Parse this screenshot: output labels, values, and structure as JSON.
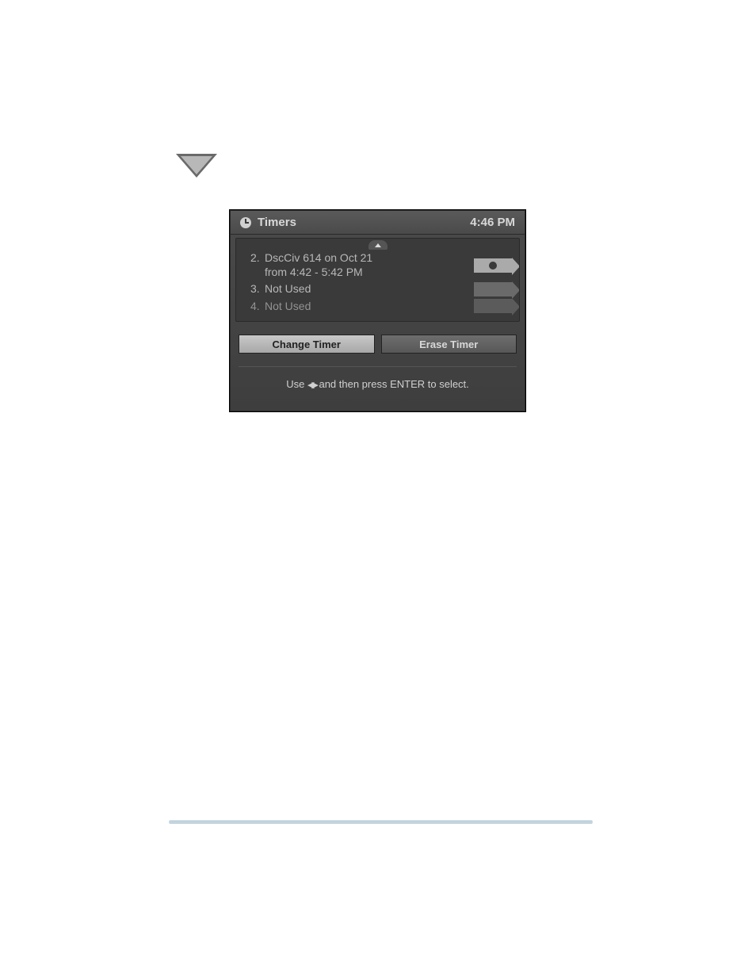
{
  "marker": {
    "name": "triangle-down-marker"
  },
  "dialog": {
    "title": "Timers",
    "clock_time": "4:46 PM",
    "timers": [
      {
        "num": "2.",
        "line1": "DscCiv 614 on Oct 21",
        "line2": "from 4:42 - 5:42 PM",
        "active": true
      },
      {
        "num": "3.",
        "line1": "Not Used",
        "line2": "",
        "active": false
      },
      {
        "num": "4.",
        "line1": "Not Used",
        "line2": "",
        "active": false
      }
    ],
    "buttons": {
      "change": "Change Timer",
      "erase": "Erase Timer"
    },
    "hint_prefix": "Use ",
    "hint_suffix": " and then press ENTER to select."
  }
}
